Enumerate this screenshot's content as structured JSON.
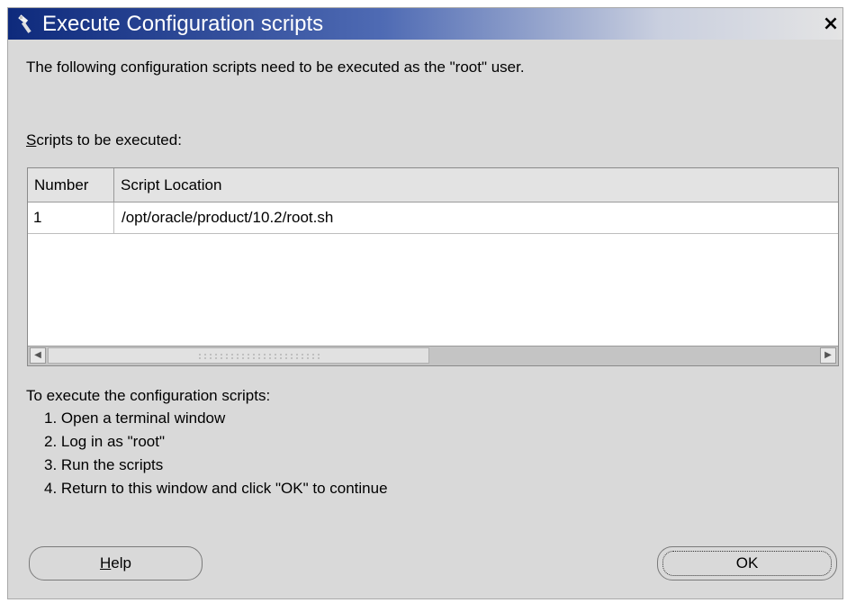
{
  "window": {
    "title": "Execute Configuration scripts",
    "close_label": "×"
  },
  "intro_text": "The following configuration scripts need to be executed as the \"root\" user.",
  "scripts_label": {
    "underlined": "S",
    "rest": "cripts to be executed:"
  },
  "table": {
    "columns": [
      "Number",
      "Script Location"
    ],
    "rows": [
      {
        "number": "1",
        "location": "/opt/oracle/product/10.2/root.sh"
      }
    ]
  },
  "instructions": {
    "title": "To execute the configuration scripts:",
    "steps": [
      "1. Open a terminal window",
      "2. Log in as \"root\"",
      "3. Run the scripts",
      "4. Return to this window and click \"OK\" to continue"
    ]
  },
  "buttons": {
    "help": {
      "underlined": "H",
      "rest": "elp"
    },
    "ok": "OK"
  },
  "colors": {
    "titlebar_start": "#0e2a7c",
    "titlebar_end": "#e4e4e4",
    "dialog_bg": "#d9d9d9"
  },
  "icons": [
    "app-icon",
    "close-icon",
    "scroll-left-icon",
    "scroll-right-icon"
  ]
}
